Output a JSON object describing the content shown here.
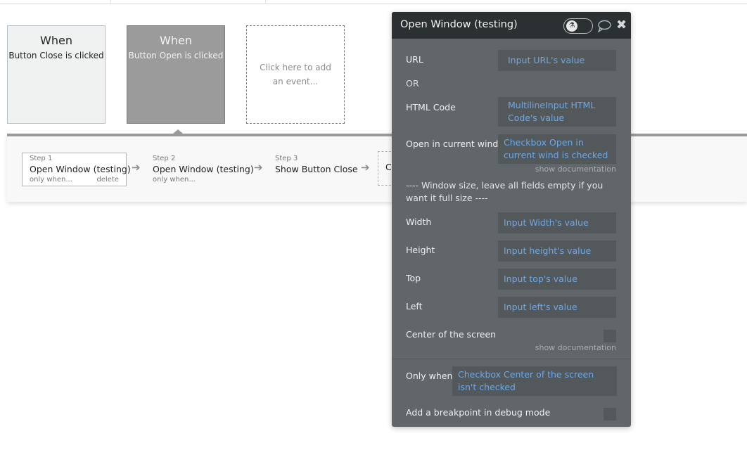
{
  "events": [
    {
      "when": "When",
      "description": "Button Close is clicked",
      "selected": false
    },
    {
      "when": "When",
      "description": "Button Open is clicked",
      "selected": true
    }
  ],
  "add_event_label": "Click here to add an event...",
  "workflow": {
    "steps": [
      {
        "number": "Step 1",
        "name": "Open Window (testing)",
        "condition": "only when...",
        "delete": "delete"
      },
      {
        "number": "Step 2",
        "name": "Open Window (testing)",
        "condition": "only when..."
      },
      {
        "number": "Step 3",
        "name": "Show Button Close"
      }
    ],
    "add_step_partial": "Cl",
    "arrow_icon": "arrow-right-icon"
  },
  "panel": {
    "title": "Open Window (testing)",
    "toggle_icon": "flask-icon",
    "comment_icon": "speech-bubble-icon",
    "close_icon": "close-icon",
    "fields": {
      "url": {
        "label": "URL",
        "value": "Input URL's value"
      },
      "or_label": "OR",
      "html_code": {
        "label": "HTML Code",
        "value": "MultilineInput HTML Code's value"
      },
      "open_current": {
        "label": "Open in current wind",
        "value": "Checkbox Open in current wind is checked"
      },
      "show_doc_1": "show documentation",
      "window_note": "---- Window size, leave all fields empty if you want it full size ----",
      "width": {
        "label": "Width",
        "value": "Input Width's value"
      },
      "height": {
        "label": "Height",
        "value": "Input height's value"
      },
      "top": {
        "label": "Top",
        "value": "Input top's value"
      },
      "left": {
        "label": "Left",
        "value": "Input left's value"
      },
      "center": {
        "label": "Center of the screen",
        "checked": false
      },
      "show_doc_2": "show documentation",
      "only_when": {
        "label": "Only when",
        "value": "Checkbox Center of the screen isn't checked"
      },
      "breakpoint": {
        "label": "Add a breakpoint in debug mode",
        "checked": false
      }
    }
  },
  "colors": {
    "panel_bg": "#61666b",
    "panel_header": "#2b3033",
    "field_bg": "#53585b",
    "field_text": "#6ea8e6"
  }
}
